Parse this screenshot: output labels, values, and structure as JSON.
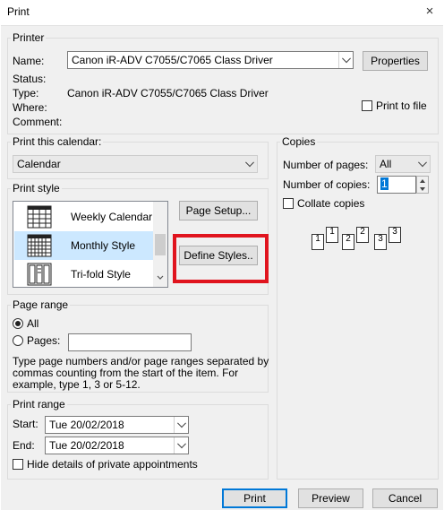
{
  "window": {
    "title": "Print",
    "close_label": "×"
  },
  "printer": {
    "legend": "Printer",
    "name_label": "Name:",
    "name_value": "Canon iR-ADV C7055/C7065 Class Driver",
    "properties_button": "Properties",
    "status_label": "Status:",
    "status_value": "",
    "type_label": "Type:",
    "type_value": "Canon iR-ADV C7055/C7065 Class Driver",
    "where_label": "Where:",
    "where_value": "",
    "comment_label": "Comment:",
    "comment_value": "",
    "print_to_file_label": "Print to file",
    "print_to_file_checked": false
  },
  "print_calendar": {
    "legend": "Print this calendar:",
    "selected": "Calendar"
  },
  "print_style": {
    "legend": "Print style",
    "items": [
      {
        "label": "Weekly Calendar S",
        "icon": "weekly-calendar-icon",
        "selected": false
      },
      {
        "label": "Monthly Style",
        "icon": "monthly-calendar-icon",
        "selected": true
      },
      {
        "label": "Tri-fold Style",
        "icon": "trifold-icon",
        "selected": false
      }
    ],
    "page_setup_button": "Page Setup...",
    "define_styles_button": "Define Styles..",
    "highlight_color": "#e0141e"
  },
  "page_range": {
    "legend": "Page range",
    "all_label": "All",
    "all_selected": true,
    "pages_label": "Pages:",
    "pages_value": "",
    "help_line1": "Type page numbers and/or page ranges separated by",
    "help_line2": "commas counting from the start of the item.  For",
    "help_line3": "example, type 1, 3 or 5-12."
  },
  "print_range": {
    "legend": "Print range",
    "start_label": "Start:",
    "start_value": "Tue 20/02/2018",
    "end_label": "End:",
    "end_value": "Tue 20/02/2018",
    "hide_private_label": "Hide details of private appointments",
    "hide_private_checked": false
  },
  "copies": {
    "legend": "Copies",
    "num_pages_label": "Number of pages:",
    "num_pages_value": "All",
    "num_copies_label": "Number of copies:",
    "num_copies_value": "1",
    "collate_label": "Collate copies",
    "collate_checked": false,
    "collate_stacks": [
      {
        "back": "1",
        "front": "1"
      },
      {
        "back": "2",
        "front": "2"
      },
      {
        "back": "3",
        "front": "3"
      }
    ]
  },
  "buttons": {
    "print": "Print",
    "preview": "Preview",
    "cancel": "Cancel"
  },
  "colors": {
    "accent": "#0078d7",
    "selection": "#cce8ff",
    "dialog_bg": "#f0f0f0"
  }
}
